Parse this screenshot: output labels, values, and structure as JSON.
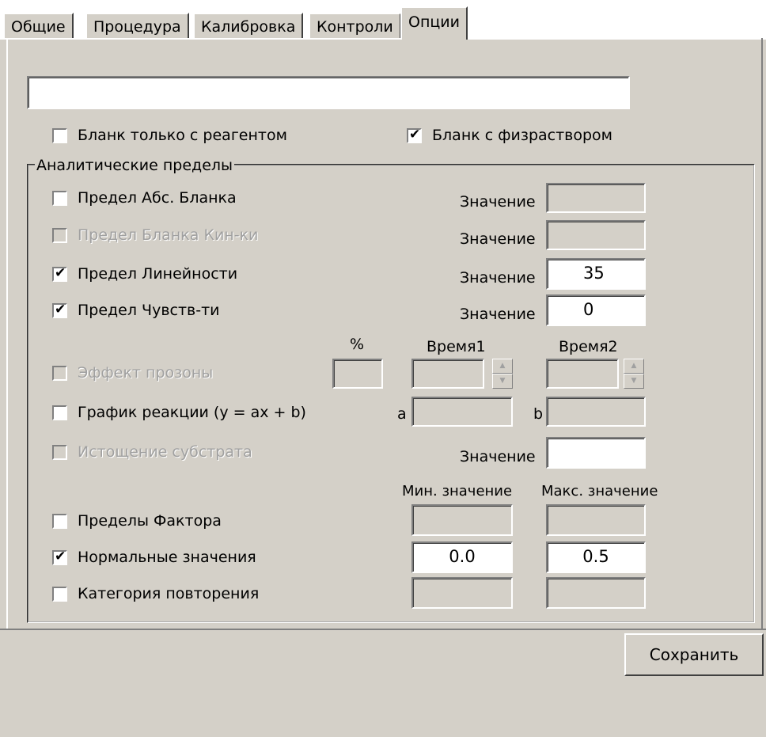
{
  "tabs": [
    {
      "label": "Общие"
    },
    {
      "label": "Процедура"
    },
    {
      "label": "Калибровка"
    },
    {
      "label": "Контроли"
    },
    {
      "label": "Опции"
    }
  ],
  "options": {
    "top_input_value": "",
    "blank_reagent": {
      "label": "Бланк только с реагентом",
      "checked": false
    },
    "blank_saline": {
      "label": "Бланк с физраствором",
      "checked": true
    }
  },
  "limits": {
    "title": "Аналитические пределы",
    "value_label": "Значение",
    "rows": [
      {
        "label": "Предел Абс. Бланка",
        "checked": false,
        "enabled": true,
        "value": ""
      },
      {
        "label": "Предел Бланка Кин-ки",
        "checked": false,
        "enabled": false,
        "value": ""
      },
      {
        "label": "Предел Линейности",
        "checked": true,
        "enabled": true,
        "value": "35"
      },
      {
        "label": "Предел Чувств-ти",
        "checked": true,
        "enabled": true,
        "value": "0"
      }
    ],
    "percent_label": "%",
    "time1_label": "Время1",
    "time2_label": "Время2",
    "prozone": {
      "label": "Эффект прозоны",
      "checked": false,
      "enabled": false
    },
    "reaction": {
      "label": "График реакции (y = ax + b)",
      "checked": false,
      "a_label": "a",
      "b_label": "b"
    },
    "substrate": {
      "label": "Истощение субстрата",
      "checked": false,
      "enabled": false,
      "value_label": "Значение",
      "value": ""
    },
    "min_label": "Мин. значение",
    "max_label": "Макс. значение",
    "factor": {
      "label": "Пределы Фактора",
      "checked": false,
      "min": "",
      "max": ""
    },
    "normal": {
      "label": "Нормальные значения",
      "checked": true,
      "min": "0.0",
      "max": "0.5"
    },
    "repeat": {
      "label": "Категория повторения",
      "checked": false,
      "min": "",
      "max": ""
    }
  },
  "save_button": "Сохранить"
}
